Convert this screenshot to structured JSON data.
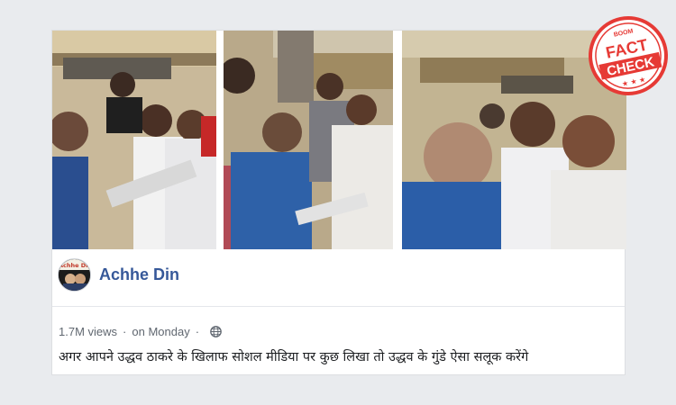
{
  "stamp": {
    "top_text": "BOOM",
    "line1": "FACT",
    "line2": "CHECK",
    "color": "#e63a35"
  },
  "post": {
    "page_name": "Achhe Din",
    "avatar_text": "Achhe Din",
    "views": "1.7M views",
    "separator": "·",
    "time": "on Monday",
    "privacy_icon": "globe-icon",
    "caption": "अगर आपने उद्धव ठाकरे के खिलाफ सोशल मीडिया पर कुछ लिखा तो उद्धव के गुंडे ऐसा सलूक करेंगे"
  },
  "colors": {
    "link_blue": "#365899",
    "meta_grey": "#606770",
    "page_bg": "#e9ebee"
  }
}
